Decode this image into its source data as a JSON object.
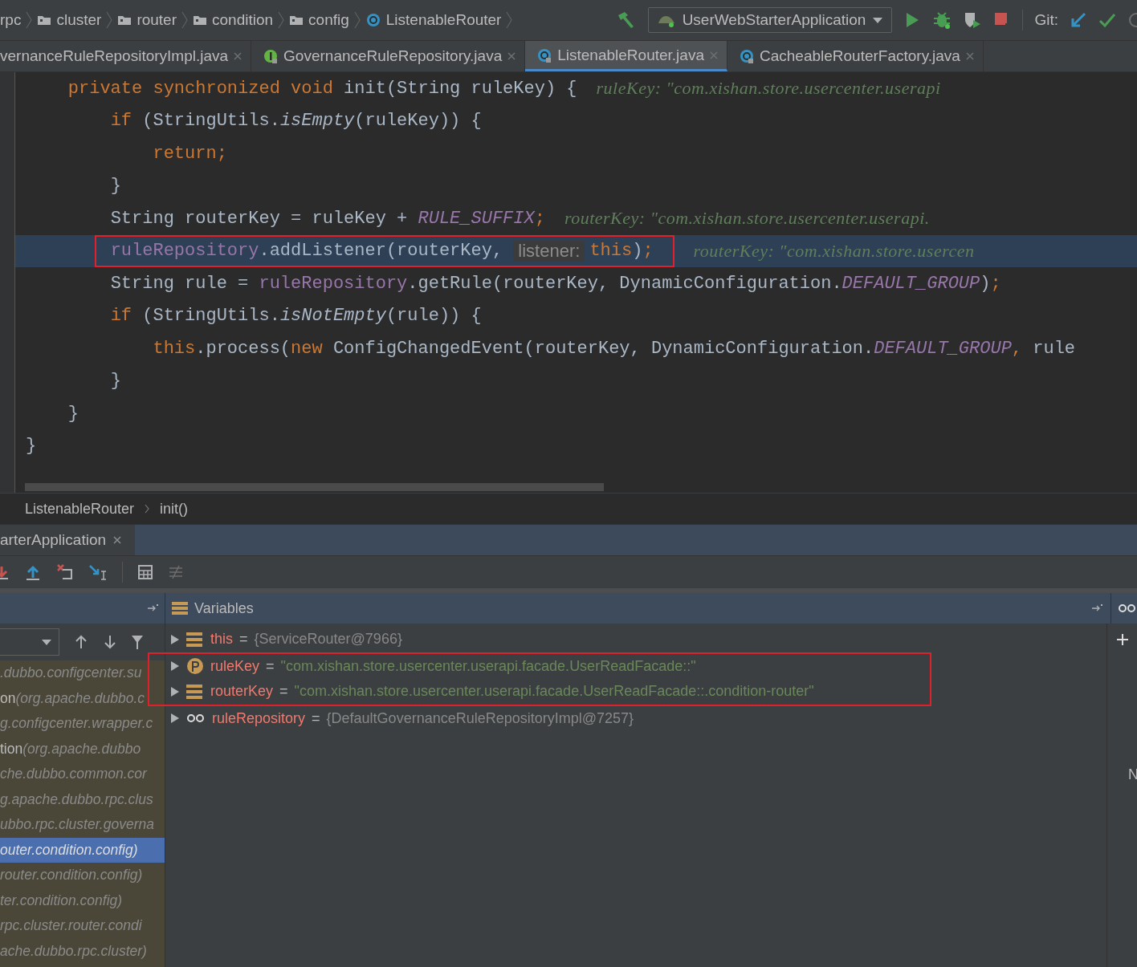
{
  "navbar": {
    "breadcrumbs": [
      {
        "label": "rpc",
        "kind": "package"
      },
      {
        "label": "cluster",
        "kind": "folder"
      },
      {
        "label": "router",
        "kind": "folder"
      },
      {
        "label": "condition",
        "kind": "folder"
      },
      {
        "label": "config",
        "kind": "folder"
      },
      {
        "label": "ListenableRouter",
        "kind": "class"
      }
    ],
    "run_config": "UserWebStarterApplication",
    "git_label": "Git:"
  },
  "editor_tabs": [
    {
      "label": "vernanceRuleRepositoryImpl.java",
      "kind": "none",
      "selected": false
    },
    {
      "label": "GovernanceRuleRepository.java",
      "kind": "interface",
      "selected": false
    },
    {
      "label": "ListenableRouter.java",
      "kind": "class",
      "selected": true
    },
    {
      "label": "CacheableRouterFactory.java",
      "kind": "class",
      "selected": false
    }
  ],
  "code_lines": [
    {
      "execution": false,
      "boxed": false,
      "tokens": [
        {
          "kind": "keyword",
          "text": "    private synchronized void "
        },
        {
          "kind": "plain",
          "text": "init(String ruleKey) {"
        },
        {
          "kind": "inline",
          "text": "ruleKey: \"com.xishan.store.usercenter.userapi"
        }
      ]
    },
    {
      "execution": false,
      "boxed": false,
      "tokens": [
        {
          "kind": "keyword",
          "text": "        if"
        },
        {
          "kind": "plain",
          "text": " (StringUtils."
        },
        {
          "kind": "static",
          "text": "isEmpty"
        },
        {
          "kind": "plain",
          "text": "(ruleKey)) {"
        }
      ]
    },
    {
      "execution": false,
      "boxed": false,
      "tokens": [
        {
          "kind": "keyword",
          "text": "            return;"
        }
      ]
    },
    {
      "execution": false,
      "boxed": false,
      "tokens": [
        {
          "kind": "plain",
          "text": "        }"
        }
      ]
    },
    {
      "execution": false,
      "boxed": false,
      "tokens": [
        {
          "kind": "plain",
          "text": "        String routerKey = ruleKey + "
        },
        {
          "kind": "constant",
          "text": "RULE_SUFFIX"
        },
        {
          "kind": "keyword",
          "text": ";"
        },
        {
          "kind": "inline",
          "text": "routerKey: \"com.xishan.store.usercenter.userapi."
        }
      ]
    },
    {
      "execution": true,
      "boxed": true,
      "tokens": [
        {
          "kind": "field",
          "text": "        ruleRepository"
        },
        {
          "kind": "plain",
          "text": ".addListener(routerKey, "
        },
        {
          "kind": "hint",
          "text": "listener:"
        },
        {
          "kind": "keyword",
          "text": "this"
        },
        {
          "kind": "plain",
          "text": ")"
        },
        {
          "kind": "keyword",
          "text": ";"
        },
        {
          "kind": "inline",
          "text": "routerKey: \"com.xishan.store.usercen"
        }
      ]
    },
    {
      "execution": false,
      "boxed": false,
      "tokens": [
        {
          "kind": "plain",
          "text": "        String rule = "
        },
        {
          "kind": "field",
          "text": "ruleRepository"
        },
        {
          "kind": "plain",
          "text": ".getRule(routerKey, DynamicConfiguration."
        },
        {
          "kind": "constant",
          "text": "DEFAULT_GROUP"
        },
        {
          "kind": "plain",
          "text": ")"
        },
        {
          "kind": "keyword",
          "text": ";"
        }
      ]
    },
    {
      "execution": false,
      "boxed": false,
      "tokens": [
        {
          "kind": "keyword",
          "text": "        if"
        },
        {
          "kind": "plain",
          "text": " (StringUtils."
        },
        {
          "kind": "static",
          "text": "isNotEmpty"
        },
        {
          "kind": "plain",
          "text": "(rule)) {"
        }
      ]
    },
    {
      "execution": false,
      "boxed": false,
      "tokens": [
        {
          "kind": "keyword",
          "text": "            this"
        },
        {
          "kind": "plain",
          "text": ".process("
        },
        {
          "kind": "keyword",
          "text": "new "
        },
        {
          "kind": "plain",
          "text": "ConfigChangedEvent(routerKey, DynamicConfiguration."
        },
        {
          "kind": "constant",
          "text": "DEFAULT_GROUP"
        },
        {
          "kind": "keyword",
          "text": ","
        },
        {
          "kind": "plain",
          "text": " rule"
        }
      ]
    },
    {
      "execution": false,
      "boxed": false,
      "tokens": [
        {
          "kind": "plain",
          "text": "        }"
        }
      ]
    },
    {
      "execution": false,
      "boxed": false,
      "tokens": [
        {
          "kind": "plain",
          "text": "    }"
        }
      ]
    },
    {
      "execution": false,
      "boxed": false,
      "tokens": [
        {
          "kind": "plain",
          "text": "}"
        }
      ]
    }
  ],
  "code_breadcrumbs": [
    "ListenableRouter",
    "init()"
  ],
  "debug_tab": {
    "label": "arterApplication",
    "selected": true
  },
  "variables_header": "Variables",
  "frames": [
    {
      "location": ".dubbo.configcenter.su",
      "selected": false
    },
    {
      "method": "on",
      "location": "(org.apache.dubbo.c",
      "selected": false
    },
    {
      "location": "g.configcenter.wrapper.c",
      "selected": false
    },
    {
      "method": "tion",
      "location": "(org.apache.dubbo",
      "selected": false
    },
    {
      "location": "che.dubbo.common.cor",
      "selected": false
    },
    {
      "location": "g.apache.dubbo.rpc.clus",
      "selected": false
    },
    {
      "location": "ubbo.rpc.cluster.governa",
      "selected": false
    },
    {
      "location": "outer.condition.config)",
      "selected": true
    },
    {
      "location": "router.condition.config)",
      "selected": false
    },
    {
      "location": "ter.condition.config)",
      "selected": false
    },
    {
      "location": "rpc.cluster.router.condi",
      "selected": false
    },
    {
      "location": "ache.dubbo.rpc.cluster)",
      "selected": false
    }
  ],
  "variables": [
    {
      "kind": "field",
      "name": "this",
      "operator": "=",
      "value": "{ServiceRouter@7966}",
      "color": "#888888",
      "boxed": false
    },
    {
      "kind": "param",
      "name": "ruleKey",
      "operator": "=",
      "value": "\"com.xishan.store.usercenter.userapi.facade.UserReadFacade::\"",
      "color": "#6a8759",
      "boxed": true
    },
    {
      "kind": "field",
      "name": "routerKey",
      "operator": "=",
      "value": "\"com.xishan.store.usercenter.userapi.facade.UserReadFacade::.condition-router\"",
      "color": "#6a8759",
      "boxed": true
    },
    {
      "kind": "watch",
      "name": "ruleRepository",
      "operator": "=",
      "value": "{DefaultGovernanceRuleRepositoryImpl@7257}",
      "color": "#888888",
      "boxed": false
    }
  ],
  "watches_hint": "N"
}
